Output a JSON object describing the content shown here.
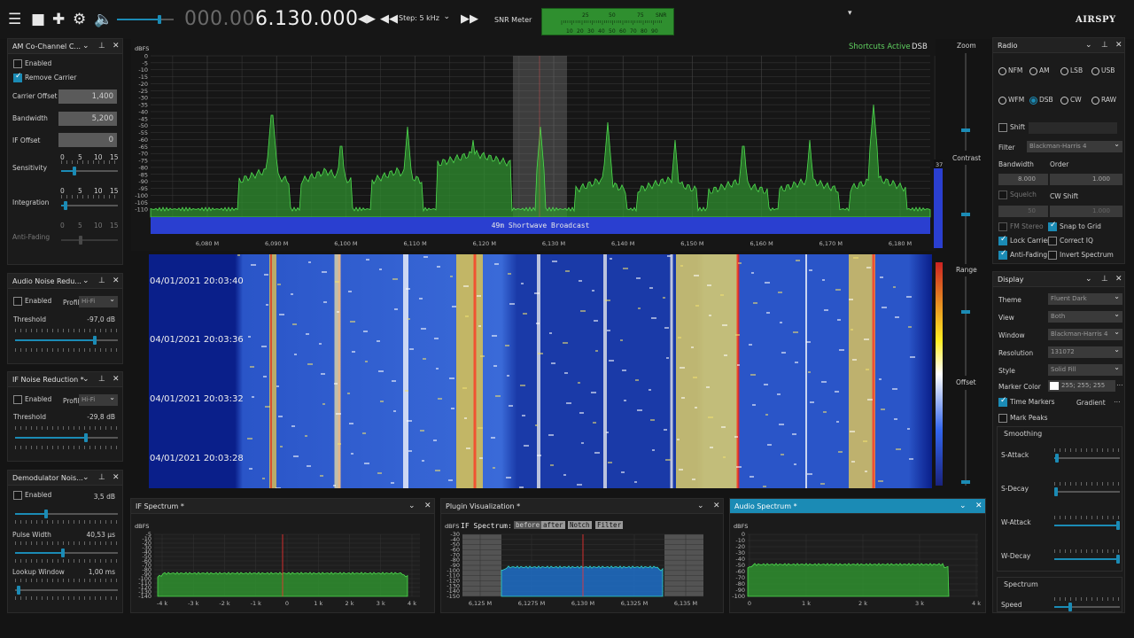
{
  "toolbar": {
    "freq_dim": "000.00",
    "freq_lit": "6.130.000",
    "step": "Step: 5 kHz",
    "snr_label": "SNR Meter",
    "snr_scale_top": [
      "25",
      "50",
      "75",
      "SNR"
    ],
    "snr_scale_bottom": [
      "10",
      "20",
      "30",
      "40",
      "50",
      "60",
      "70",
      "80",
      "90"
    ],
    "brand": "AIRSPY"
  },
  "am_cochannel": {
    "title": "AM Co-Channel C...",
    "enabled": "Enabled",
    "remove_carrier": "Remove Carrier",
    "carrier_offset_label": "Carrier Offset",
    "carrier_offset": "1,400",
    "bandwidth_label": "Bandwidth",
    "bandwidth": "5,200",
    "if_offset_label": "IF Offset",
    "if_offset": "0",
    "sensitivity": "Sensitivity",
    "integration": "Integration",
    "anti_fading": "Anti-Fading",
    "scale": [
      "0",
      "5",
      "10",
      "15"
    ]
  },
  "audio_nr": {
    "title": "Audio Noise Redu...",
    "enabled": "Enabled",
    "profile_label": "Profile:",
    "profile": "Hi-Fi",
    "threshold_label": "Threshold",
    "threshold": "-97,0 dB"
  },
  "if_nr": {
    "title": "IF Noise Reduction *",
    "enabled": "Enabled",
    "profile_label": "Profile:",
    "profile": "Hi-Fi",
    "threshold_label": "Threshold",
    "threshold": "-29,8 dB"
  },
  "demod_nb": {
    "title": "Demodulator Nois...",
    "enabled": "Enabled",
    "enabled_val": "3,5 dB",
    "pulse_label": "Pulse Width",
    "pulse": "40,53 µs",
    "lookup_label": "Lookup Window",
    "lookup": "1,00 ms"
  },
  "spectrum": {
    "dbfs": "dBFS",
    "shortcuts": "Shortcuts Active",
    "mode": "DSB",
    "band_label": "49m Shortwave Broadcast",
    "db_ticks": [
      "0",
      "-5",
      "-10",
      "-15",
      "-20",
      "-25",
      "-30",
      "-35",
      "-40",
      "-45",
      "-50",
      "-55",
      "-60",
      "-65",
      "-70",
      "-75",
      "-80",
      "-85",
      "-90",
      "-95",
      "-100",
      "-105",
      "-110"
    ],
    "freq_ticks": [
      "6,080 M",
      "6,090 M",
      "6,100 M",
      "6,110 M",
      "6,120 M",
      "6,130 M",
      "6,140 M",
      "6,150 M",
      "6,160 M",
      "6,170 M",
      "6,180 M"
    ],
    "side_value": "37"
  },
  "waterfall": {
    "timestamps": [
      "04/01/2021 20:03:40",
      "04/01/2021 20:03:36",
      "04/01/2021 20:03:32",
      "04/01/2021 20:03:28"
    ]
  },
  "vcontrols": {
    "zoom": "Zoom",
    "contrast": "Contrast",
    "range": "Range",
    "offset": "Offset"
  },
  "radio": {
    "title": "Radio",
    "modes_row1": [
      "NFM",
      "AM",
      "LSB",
      "USB"
    ],
    "modes_row2": [
      "WFM",
      "DSB",
      "CW",
      "RAW"
    ],
    "selected_mode": "DSB",
    "shift": "Shift",
    "filter_label": "Filter",
    "filter": "Blackman-Harris 4",
    "bandwidth_label": "Bandwidth",
    "order_label": "Order",
    "bandwidth": "8.000",
    "order": "1.000",
    "squelch": "Squelch",
    "cw_shift": "CW Shift",
    "squelch_val": "50",
    "cw_shift_val": "1.000",
    "fm_stereo": "FM Stereo",
    "snap_to_grid": "Snap to Grid",
    "lock_carrier": "Lock Carrier",
    "correct_iq": "Correct IQ",
    "anti_fading": "Anti-Fading",
    "invert_spectrum": "Invert Spectrum"
  },
  "display": {
    "title": "Display",
    "theme_label": "Theme",
    "theme": "Fluent Dark",
    "view_label": "View",
    "view": "Both",
    "window_label": "Window",
    "window": "Blackman-Harris 4",
    "resolution_label": "Resolution",
    "resolution": "131072",
    "style_label": "Style",
    "style": "Solid Fill",
    "marker_color_label": "Marker Color",
    "marker_color": "255; 255; 255",
    "time_markers": "Time Markers",
    "gradient": "Gradient",
    "mark_peaks": "Mark Peaks",
    "smoothing": "Smoothing",
    "s_attack": "S-Attack",
    "s_decay": "S-Decay",
    "w_attack": "W-Attack",
    "w_decay": "W-Decay",
    "spectrum_section": "Spectrum",
    "speed": "Speed"
  },
  "if_spectrum": {
    "title": "IF Spectrum *",
    "dbfs": "dBFS",
    "db_ticks": [
      "-5",
      "-10",
      "-20",
      "-30",
      "-40",
      "-50",
      "-60",
      "-70",
      "-80",
      "-90",
      "-100",
      "-110",
      "-120",
      "-130",
      "-140"
    ],
    "x_ticks": [
      "-4 k",
      "-3 k",
      "-2 k",
      "-1 k",
      "0",
      "1 k",
      "2 k",
      "3 k",
      "4 k"
    ]
  },
  "plugin_vis": {
    "title": "Plugin Visualization *",
    "dbfs": "dBFS",
    "label": "IF Spectrum:",
    "btn_before": "before",
    "btn_after": "after",
    "btn_notch": "Notch",
    "btn_filter": "Filter",
    "db_ticks": [
      "-30",
      "-40",
      "-50",
      "-60",
      "-70",
      "-80",
      "-90",
      "-100",
      "-110",
      "-120",
      "-130",
      "-140",
      "-150"
    ],
    "x_ticks": [
      "6,125 M",
      "6,1275 M",
      "6,130 M",
      "6,1325 M",
      "6,135 M"
    ]
  },
  "audio_spectrum": {
    "title": "Audio Spectrum *",
    "dbfs": "dBFS",
    "db_ticks": [
      "0",
      "-10",
      "-20",
      "-30",
      "-40",
      "-50",
      "-60",
      "-70",
      "-80",
      "-90",
      "-100"
    ],
    "x_ticks": [
      "0",
      "1 k",
      "2 k",
      "3 k",
      "4 k"
    ]
  },
  "colors": {
    "accent": "#1b8bb5",
    "spectrum_fill": "#2f8f2f",
    "band_bar": "#2a3fd0"
  }
}
